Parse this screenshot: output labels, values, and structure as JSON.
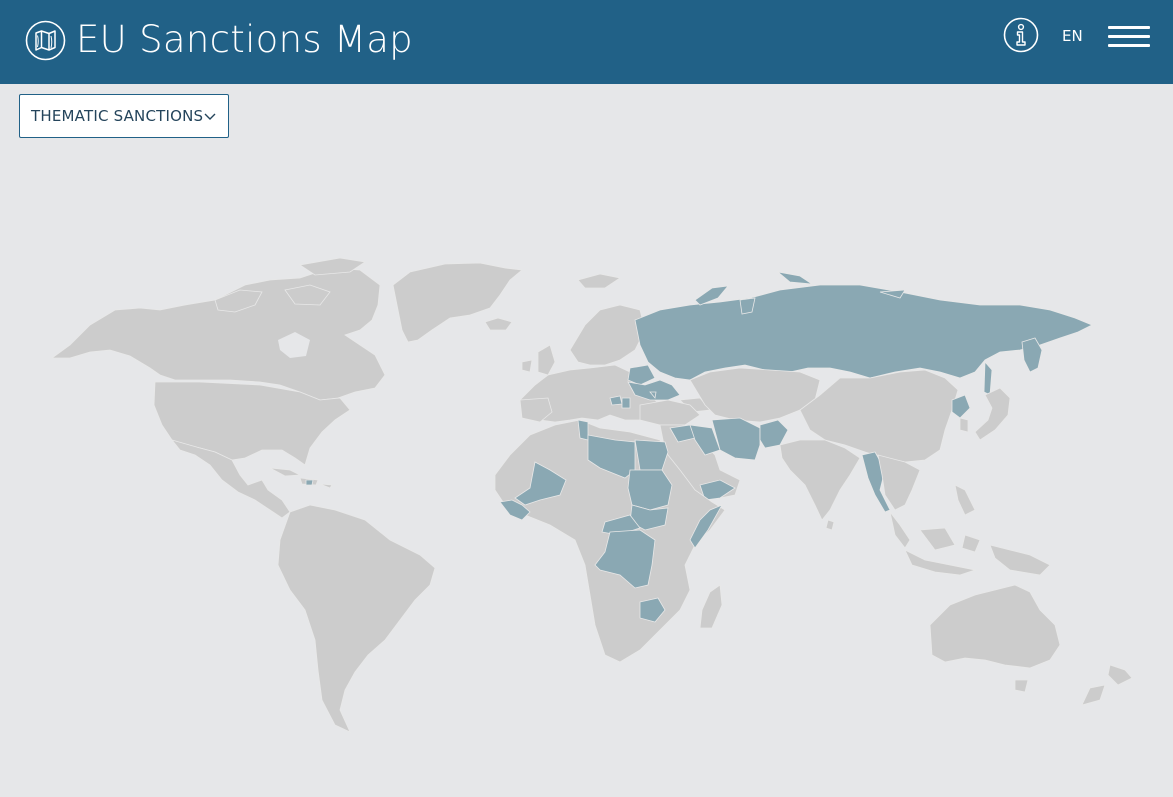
{
  "header": {
    "title": "EU Sanctions Map",
    "logo_icon": "folded-map-icon",
    "info_icon": "info-icon",
    "language": "EN",
    "menu_icon": "hamburger-menu-icon"
  },
  "filter": {
    "selected": "THEMATIC SANCTIONS",
    "chevron_icon": "chevron-down-icon"
  },
  "map": {
    "colors": {
      "header_bg": "#216187",
      "background": "#e6e7e9",
      "land": "#cccccc",
      "sanctioned": "#8aa8b3"
    }
  }
}
